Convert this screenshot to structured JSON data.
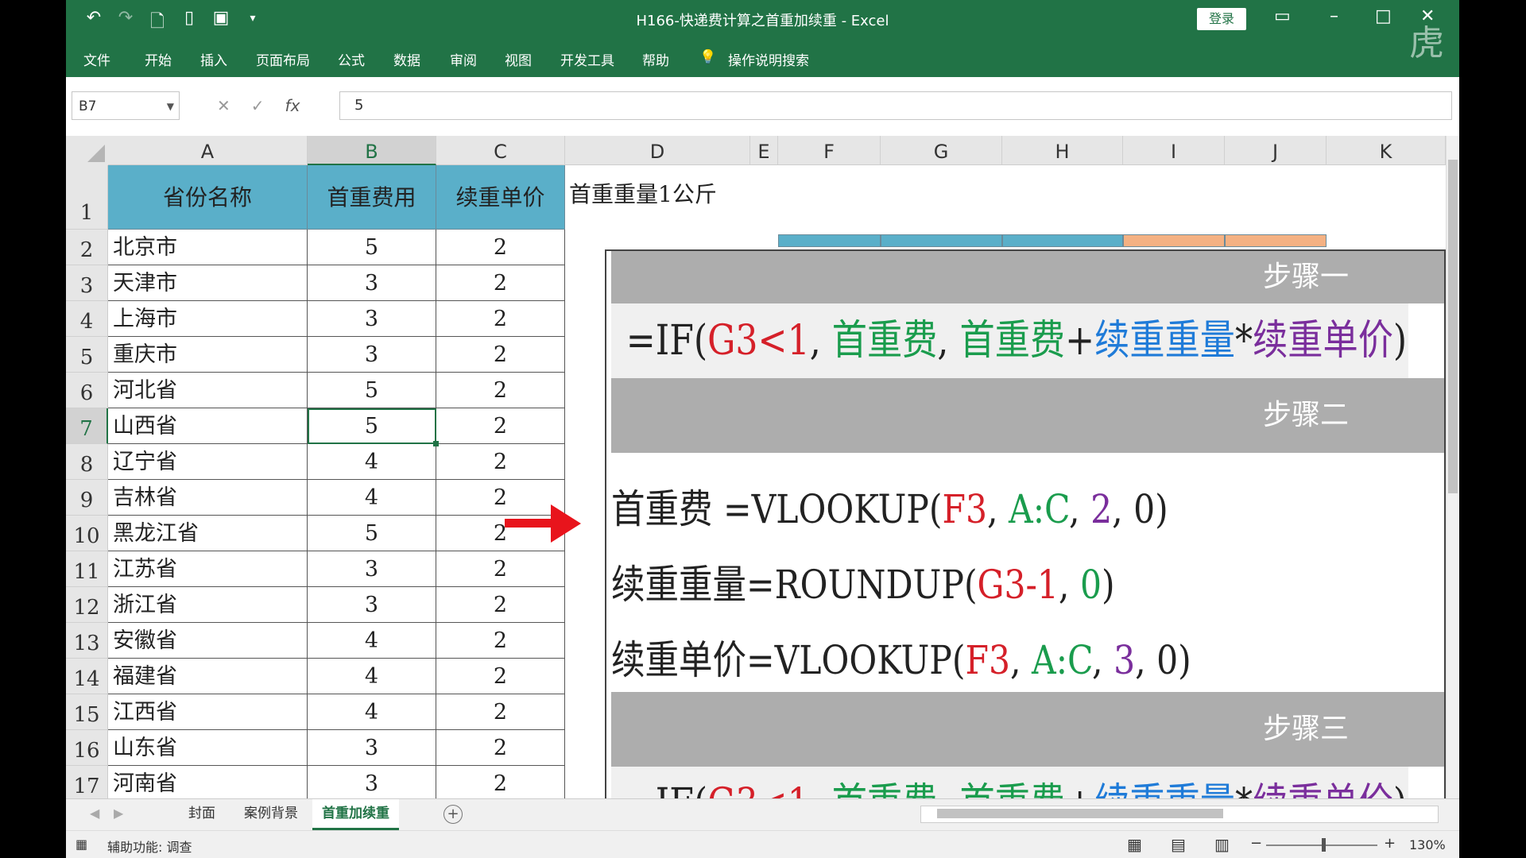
{
  "window": {
    "title": "H166-快递费计算之首重加续重  -  Excel",
    "login_label": "登录"
  },
  "ribbon": {
    "tabs": [
      "文件",
      "开始",
      "插入",
      "页面布局",
      "公式",
      "数据",
      "审阅",
      "视图",
      "开发工具",
      "帮助"
    ],
    "search_label": "操作说明搜索"
  },
  "formula_bar": {
    "name_box": "B7",
    "content": "5",
    "fx": "fx"
  },
  "columns": [
    "A",
    "B",
    "C",
    "D",
    "E",
    "F",
    "G",
    "H",
    "I",
    "J",
    "K"
  ],
  "table": {
    "headers": [
      "省份名称",
      "首重费用",
      "续重单价"
    ],
    "rows": [
      [
        "北京市",
        "5",
        "2"
      ],
      [
        "天津市",
        "3",
        "2"
      ],
      [
        "上海市",
        "3",
        "2"
      ],
      [
        "重庆市",
        "3",
        "2"
      ],
      [
        "河北省",
        "5",
        "2"
      ],
      [
        "山西省",
        "5",
        "2"
      ],
      [
        "辽宁省",
        "4",
        "2"
      ],
      [
        "吉林省",
        "4",
        "2"
      ],
      [
        "黑龙江省",
        "5",
        "2"
      ],
      [
        "江苏省",
        "3",
        "2"
      ],
      [
        "浙江省",
        "3",
        "2"
      ],
      [
        "安徽省",
        "4",
        "2"
      ],
      [
        "福建省",
        "4",
        "2"
      ],
      [
        "江西省",
        "4",
        "2"
      ],
      [
        "山东省",
        "3",
        "2"
      ],
      [
        "河南省",
        "3",
        "2"
      ]
    ]
  },
  "row_numbers": [
    "1",
    "2",
    "3",
    "4",
    "5",
    "6",
    "7",
    "8",
    "9",
    "10",
    "11",
    "12",
    "13",
    "14",
    "15",
    "16",
    "17"
  ],
  "note": "首重重量1公斤",
  "overlay": {
    "step1": "步骤一",
    "step2": "步骤二",
    "step3": "步骤三",
    "formula1": {
      "p1": "=IF(",
      "p2": "G3<1",
      "p3": ", ",
      "p4": "首重费",
      "p5": ", ",
      "p6": "首重费",
      "p7": "+",
      "p8": "续重重量",
      "p9": "*",
      "p10": "续重单价",
      "p11": ")"
    },
    "formula2": {
      "p1": "首重费  =VLOOKUP(",
      "p2": "F3",
      "p3": ", ",
      "p4": "A:C",
      "p5": ", ",
      "p6": "2",
      "p7": ", 0)"
    },
    "formula3": {
      "p1": "续重重量=ROUNDUP(",
      "p2": "G3-1",
      "p3": ", ",
      "p4": "0",
      "p5": ")"
    },
    "formula4": {
      "p1": "续重单价=VLOOKUP(",
      "p2": "F3",
      "p3": ", ",
      "p4": "A:C",
      "p5": ", ",
      "p6": "3",
      "p7": ", 0)"
    }
  },
  "sheet_tabs": [
    "封面",
    "案例背景",
    "首重加续重"
  ],
  "status": {
    "accessibility": "辅助功能: 调查",
    "zoom": "130%"
  },
  "colors": {
    "excel_green": "#217346",
    "header_fill": "#5aafc9",
    "arrow_red": "#e8141c"
  }
}
